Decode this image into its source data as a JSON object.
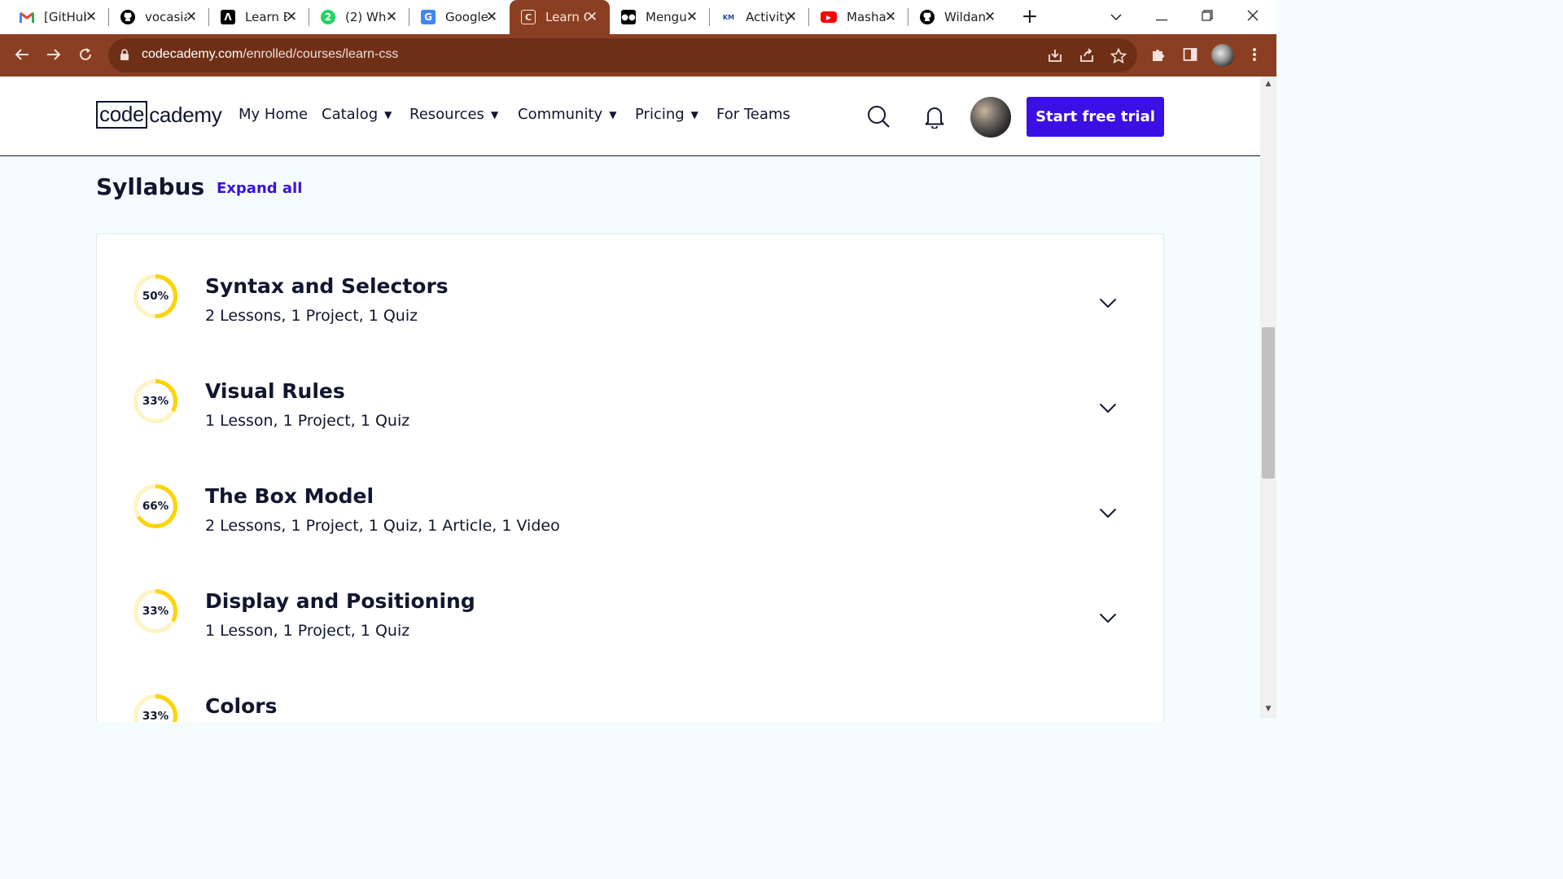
{
  "browser": {
    "tabs": [
      {
        "title": "[GitHub]",
        "icon": "gmail-icon",
        "color": "#ea4335"
      },
      {
        "title": "vocasia",
        "icon": "github-icon",
        "color": "#000000"
      },
      {
        "title": "Learn E",
        "icon": "learn-icon",
        "color": "#000000"
      },
      {
        "title": "(2) Wh",
        "icon": "whatsapp-icon",
        "color": "#25d366"
      },
      {
        "title": "Google",
        "icon": "google-translate-icon",
        "color": "#4285f4"
      },
      {
        "title": "Learn C",
        "icon": "codecademy-icon",
        "color": "#f5e7e0",
        "active": true
      },
      {
        "title": "Mengu",
        "icon": "medium-icon",
        "color": "#000000"
      },
      {
        "title": "Activity",
        "icon": "kampus-merdeka-icon",
        "color": "#1f4aa8"
      },
      {
        "title": "Masha",
        "icon": "youtube-icon",
        "color": "#ff0000"
      },
      {
        "title": "Wildan",
        "icon": "github-icon",
        "color": "#000000"
      }
    ],
    "url_host": "codecademy.com",
    "url_path": "/enrolled/courses/learn-css"
  },
  "header": {
    "logo_left": "code",
    "logo_right": "cademy",
    "nav": [
      {
        "label": "My Home",
        "dropdown": false
      },
      {
        "label": "Catalog",
        "dropdown": true
      },
      {
        "label": "Resources",
        "dropdown": true
      },
      {
        "label": "Community",
        "dropdown": true
      },
      {
        "label": "Pricing",
        "dropdown": true
      },
      {
        "label": "For Teams",
        "dropdown": false
      }
    ],
    "cta_label": "Start free trial"
  },
  "syllabus": {
    "title": "Syllabus",
    "expand_label": "Expand all",
    "modules": [
      {
        "title": "Syntax and Selectors",
        "summary": "2 Lessons, 1 Project, 1 Quiz",
        "progress_label": "50%",
        "progress": 0.5
      },
      {
        "title": "Visual Rules",
        "summary": "1 Lesson, 1 Project, 1 Quiz",
        "progress_label": "33%",
        "progress": 0.33
      },
      {
        "title": "The Box Model",
        "summary": "2 Lessons, 1 Project, 1 Quiz, 1 Article, 1 Video",
        "progress_label": "66%",
        "progress": 0.66
      },
      {
        "title": "Display and Positioning",
        "summary": "1 Lesson, 1 Project, 1 Quiz",
        "progress_label": "33%",
        "progress": 0.33
      },
      {
        "title": "Colors",
        "summary": "",
        "progress_label": "33%",
        "progress": 0.33
      }
    ]
  },
  "colors": {
    "accent": "#3a10e5",
    "progress": "#ffd300",
    "progress_track": "#fff4c2",
    "browser_frame": "#8b3f22"
  }
}
